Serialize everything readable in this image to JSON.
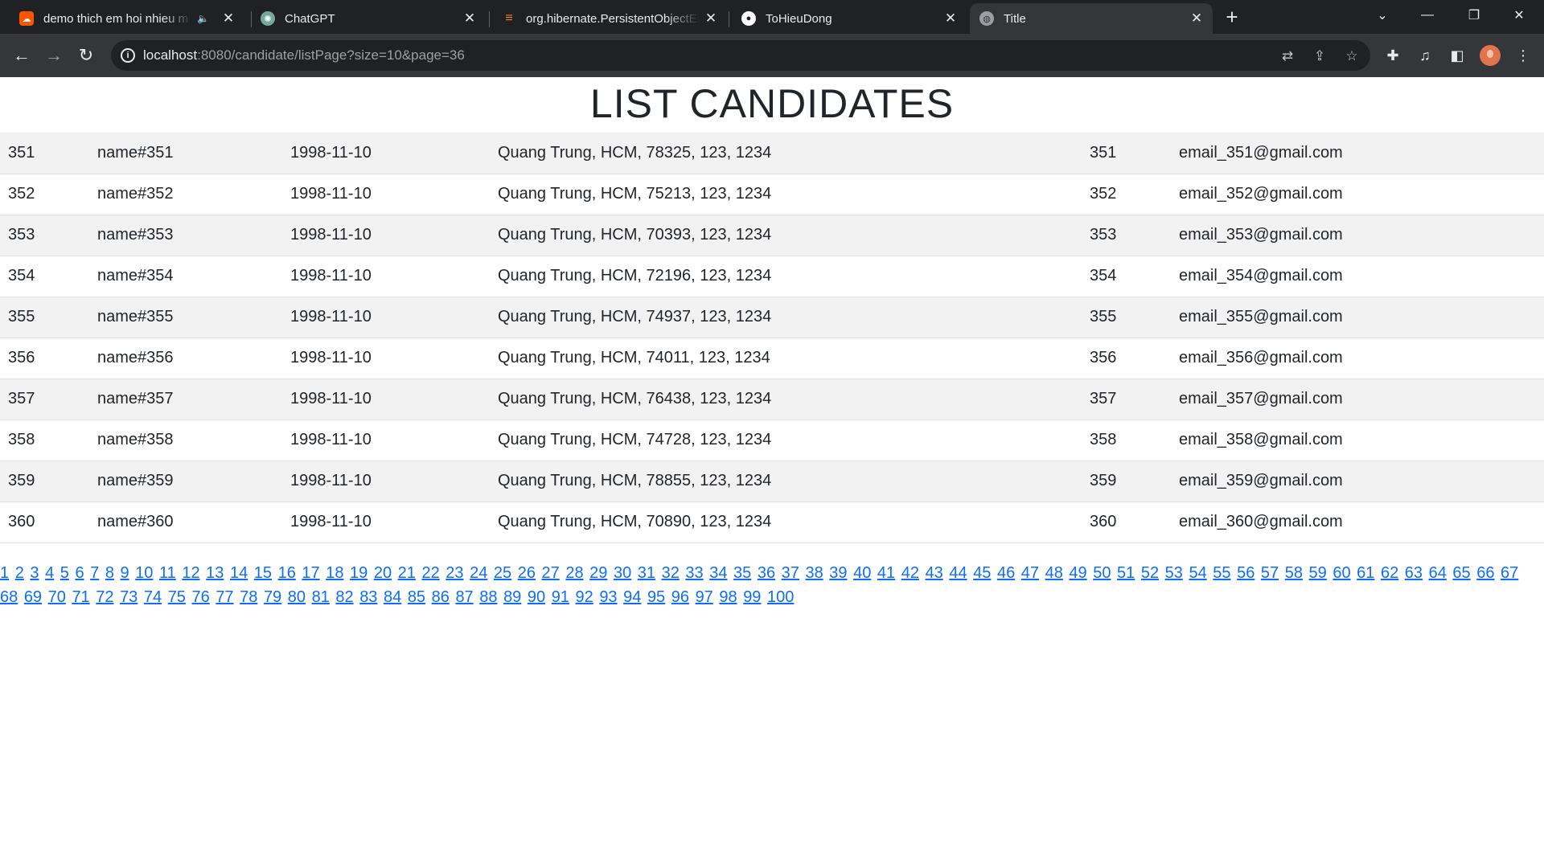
{
  "browser": {
    "tabs": [
      {
        "title": "demo thich em hoi nhieu m",
        "icon": "soundcloud-icon",
        "color": "#ff5500",
        "muted_indicator": "speaker-icon"
      },
      {
        "title": "ChatGPT",
        "icon": "chatgpt-icon",
        "color": "#74aa9c"
      },
      {
        "title": "org.hibernate.PersistentObjectEx",
        "icon": "stackoverflow-icon",
        "color": "#f48024"
      },
      {
        "title": "ToHieuDong",
        "icon": "github-icon",
        "color": "#ffffff"
      },
      {
        "title": "Title",
        "icon": "globe-icon",
        "color": "#9aa0a6"
      }
    ],
    "url_host": "localhost",
    "url_rest": ":8080/candidate/listPage?size=10&page=36"
  },
  "page": {
    "title": "LIST CANDIDATES"
  },
  "candidates": [
    {
      "id": "351",
      "name": "name#351",
      "dob": "1998-11-10",
      "address": "Quang Trung, HCM, 78325, 123, 1234",
      "phone": "351",
      "email": "email_351@gmail.com"
    },
    {
      "id": "352",
      "name": "name#352",
      "dob": "1998-11-10",
      "address": "Quang Trung, HCM, 75213, 123, 1234",
      "phone": "352",
      "email": "email_352@gmail.com"
    },
    {
      "id": "353",
      "name": "name#353",
      "dob": "1998-11-10",
      "address": "Quang Trung, HCM, 70393, 123, 1234",
      "phone": "353",
      "email": "email_353@gmail.com"
    },
    {
      "id": "354",
      "name": "name#354",
      "dob": "1998-11-10",
      "address": "Quang Trung, HCM, 72196, 123, 1234",
      "phone": "354",
      "email": "email_354@gmail.com"
    },
    {
      "id": "355",
      "name": "name#355",
      "dob": "1998-11-10",
      "address": "Quang Trung, HCM, 74937, 123, 1234",
      "phone": "355",
      "email": "email_355@gmail.com"
    },
    {
      "id": "356",
      "name": "name#356",
      "dob": "1998-11-10",
      "address": "Quang Trung, HCM, 74011, 123, 1234",
      "phone": "356",
      "email": "email_356@gmail.com"
    },
    {
      "id": "357",
      "name": "name#357",
      "dob": "1998-11-10",
      "address": "Quang Trung, HCM, 76438, 123, 1234",
      "phone": "357",
      "email": "email_357@gmail.com"
    },
    {
      "id": "358",
      "name": "name#358",
      "dob": "1998-11-10",
      "address": "Quang Trung, HCM, 74728, 123, 1234",
      "phone": "358",
      "email": "email_358@gmail.com"
    },
    {
      "id": "359",
      "name": "name#359",
      "dob": "1998-11-10",
      "address": "Quang Trung, HCM, 78855, 123, 1234",
      "phone": "359",
      "email": "email_359@gmail.com"
    },
    {
      "id": "360",
      "name": "name#360",
      "dob": "1998-11-10",
      "address": "Quang Trung, HCM, 70890, 123, 1234",
      "phone": "360",
      "email": "email_360@gmail.com"
    }
  ],
  "pagination": {
    "pages": [
      "1",
      "2",
      "3",
      "4",
      "5",
      "6",
      "7",
      "8",
      "9",
      "10",
      "11",
      "12",
      "13",
      "14",
      "15",
      "16",
      "17",
      "18",
      "19",
      "20",
      "21",
      "22",
      "23",
      "24",
      "25",
      "26",
      "27",
      "28",
      "29",
      "30",
      "31",
      "32",
      "33",
      "34",
      "35",
      "36",
      "37",
      "38",
      "39",
      "40",
      "41",
      "42",
      "43",
      "44",
      "45",
      "46",
      "47",
      "48",
      "49",
      "50",
      "51",
      "52",
      "53",
      "54",
      "55",
      "56",
      "57",
      "58",
      "59",
      "60",
      "61",
      "62",
      "63",
      "64",
      "65",
      "66",
      "67",
      "68",
      "69",
      "70",
      "71",
      "72",
      "73",
      "74",
      "75",
      "76",
      "77",
      "78",
      "79",
      "80",
      "81",
      "82",
      "83",
      "84",
      "85",
      "86",
      "87",
      "88",
      "89",
      "90",
      "91",
      "92",
      "93",
      "94",
      "95",
      "96",
      "97",
      "98",
      "99",
      "100"
    ],
    "link_color": "#0d6efd"
  },
  "colors": {
    "chrome_dark": "#202124",
    "chrome_toolbar": "#35363a",
    "row_stripe": "#f2f2f2",
    "text": "#212529"
  }
}
